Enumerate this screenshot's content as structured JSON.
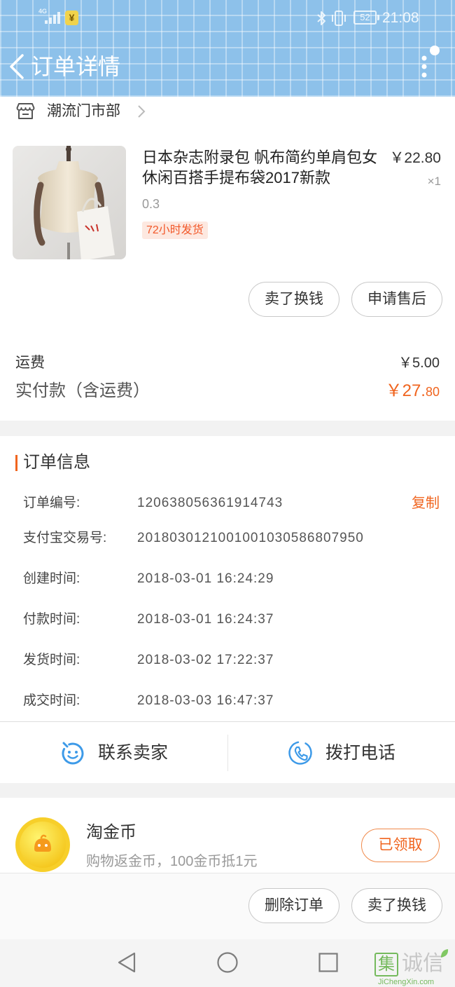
{
  "colors": {
    "header_bg": "#8dc1ea",
    "accent_orange": "#f0641e",
    "icon_blue": "#3d9ae8",
    "badge_bg": "#fde8e0",
    "badge_text": "#f2592a",
    "page_gray": "#f2f2f2",
    "watermark_green": "#5fb043"
  },
  "status_bar": {
    "network": "4G",
    "pay_badge": "¥",
    "battery_level": "52",
    "time": "21:08",
    "icons": [
      "signal-icon",
      "payment-notification-icon",
      "bluetooth-icon",
      "vibrate-icon",
      "battery-icon"
    ]
  },
  "header": {
    "back_icon": "chevron-left-icon",
    "title": "订单详情",
    "menu_icon": "more-vertical-icon"
  },
  "store": {
    "icon": "shop-icon",
    "name": "潮流门市部"
  },
  "product": {
    "title": "日本杂志附录包 帆布简约单肩包女休闲百搭手提布袋2017新款",
    "price": "￥22.80",
    "quantity": "×1",
    "sku": "0.3",
    "badge": "72小时发货"
  },
  "item_actions": [
    {
      "label": "卖了换钱"
    },
    {
      "label": "申请售后"
    }
  ],
  "fees": {
    "shipping_label": "运费",
    "shipping_value": "￥5.00",
    "total_label": "实付款（含运费）",
    "total_integer": "￥27.",
    "total_fraction": "80"
  },
  "order_info": {
    "title": "订单信息",
    "copy_label": "复制",
    "rows": [
      {
        "label": "订单编号:",
        "value": "120638056361914743"
      },
      {
        "label": "支付宝交易号:",
        "value": "2018030121001001030586807950"
      },
      {
        "label": "创建时间:",
        "value": "2018-03-01 16:24:29"
      },
      {
        "label": "付款时间:",
        "value": "2018-03-01 16:24:37"
      },
      {
        "label": "发货时间:",
        "value": "2018-03-02 17:22:37"
      },
      {
        "label": "成交时间:",
        "value": "2018-03-03 16:47:37"
      }
    ]
  },
  "contact": {
    "seller_icon": "chat-smile-icon",
    "seller_label": "联系卖家",
    "phone_icon": "phone-icon",
    "phone_label": "拨打电话"
  },
  "coins": {
    "icon": "gold-coin-icon",
    "title": "淘金币",
    "subtitle": "购物返金币，100金币抵1元",
    "button": "已领取"
  },
  "bottom_actions": [
    {
      "label": "删除订单"
    },
    {
      "label": "卖了换钱"
    }
  ],
  "nav_bar": {
    "icons": [
      "nav-back-icon",
      "nav-home-icon",
      "nav-recents-icon"
    ]
  },
  "watermark": {
    "mark": "集",
    "name": "诚信",
    "url": "JiChengXin.com"
  }
}
